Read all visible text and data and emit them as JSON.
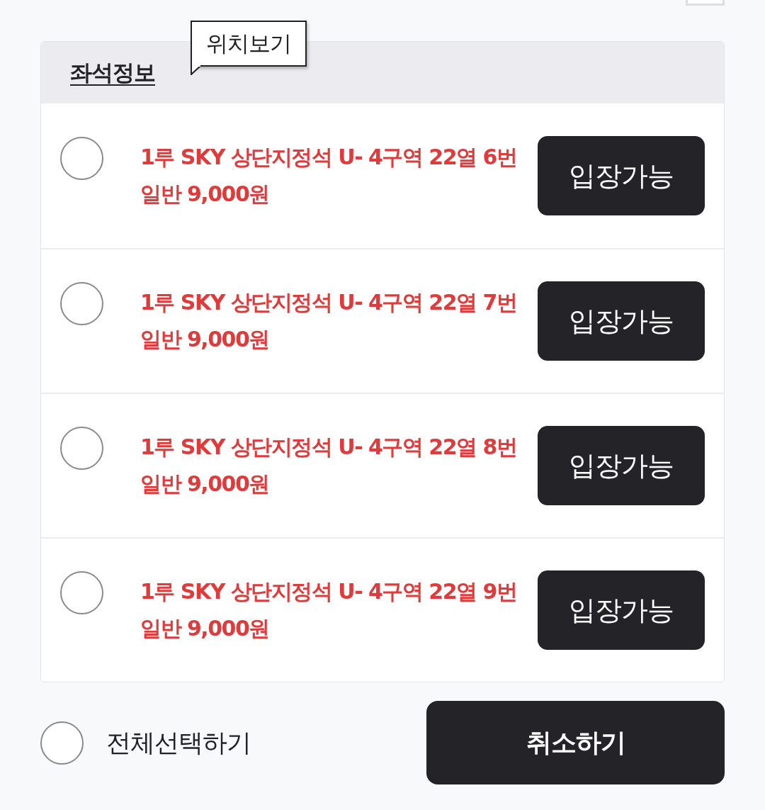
{
  "seat_info": {
    "title": "좌석정보",
    "tooltip": "위치보기"
  },
  "seats": [
    {
      "selected": false,
      "seat": "1루 SKY 상단지정석 U- 4구역 22열 6번",
      "price": "일반 9,000원",
      "status": "입장가능"
    },
    {
      "selected": false,
      "seat": "1루 SKY 상단지정석 U- 4구역 22열 7번",
      "price": "일반 9,000원",
      "status": "입장가능"
    },
    {
      "selected": false,
      "seat": "1루 SKY 상단지정석 U- 4구역 22열 8번",
      "price": "일반 9,000원",
      "status": "입장가능"
    },
    {
      "selected": false,
      "seat": "1루 SKY 상단지정석 U- 4구역 22열 9번",
      "price": "일반 9,000원",
      "status": "입장가능"
    }
  ],
  "footer": {
    "select_all": {
      "label": "전체선택하기",
      "checked": false
    },
    "cancel_button": "취소하기"
  }
}
